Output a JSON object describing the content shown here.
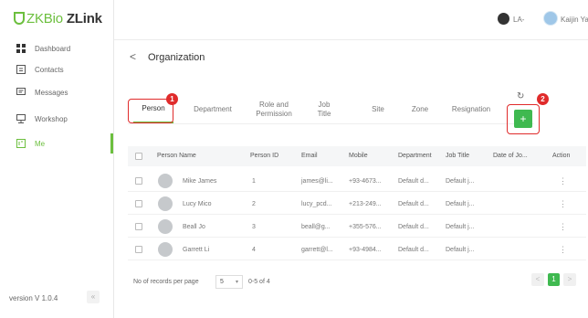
{
  "app": {
    "logo_brand": "ZKBio",
    "logo_product": "ZLink"
  },
  "sidebar": {
    "items": [
      {
        "label": "Dashboard",
        "icon": "grid-icon"
      },
      {
        "label": "Contacts",
        "icon": "contacts-icon"
      },
      {
        "label": "Messages",
        "icon": "message-icon"
      },
      {
        "label": "Workshop",
        "icon": "workshop-icon"
      },
      {
        "label": "Me",
        "icon": "me-icon",
        "active": true
      }
    ],
    "version": "version V 1.0.4",
    "collapse_glyph": "«"
  },
  "header": {
    "lang": "LA-",
    "user": "Kaijin Yang-"
  },
  "page": {
    "back_glyph": "<",
    "title": "Organization"
  },
  "tabs": [
    {
      "label": "Person"
    },
    {
      "label": "Department"
    },
    {
      "label": "Role and\nPermission"
    },
    {
      "label": "Job\nTitle"
    },
    {
      "label": "Site"
    },
    {
      "label": "Zone"
    },
    {
      "label": "Resignation"
    }
  ],
  "toolbar": {
    "refresh_glyph": "↻",
    "add_glyph": "+"
  },
  "annotations": [
    "1",
    "2"
  ],
  "table": {
    "headers": [
      "Person Name",
      "Person ID",
      "Email",
      "Mobile",
      "Department",
      "Job Title",
      "Date of Jo...",
      "Action"
    ],
    "rows": [
      [
        "Mike James",
        "1",
        "james@li...",
        "+93-4673...",
        "Default d...",
        "Default j..."
      ],
      [
        "Lucy Mico",
        "2",
        "lucy_pcd...",
        "+213-249...",
        "Default d...",
        "Default j..."
      ],
      [
        "Beall Jo",
        "3",
        "beall@g...",
        "+355-576...",
        "Default d...",
        "Default j..."
      ],
      [
        "Garrett Li",
        "4",
        "garrett@l...",
        "+93-4984...",
        "Default d...",
        "Default j..."
      ]
    ],
    "action_glyph": "⋮"
  },
  "pagination": {
    "per_page_label": "No of records per page",
    "page_size": "5",
    "range": "0-5 of 4",
    "current_page": "1",
    "prev_glyph": "<",
    "next_glyph": ">"
  },
  "colors": {
    "accent": "#6cbf3e",
    "primary_button": "#3fb950",
    "annotation": "#e02b2b"
  }
}
